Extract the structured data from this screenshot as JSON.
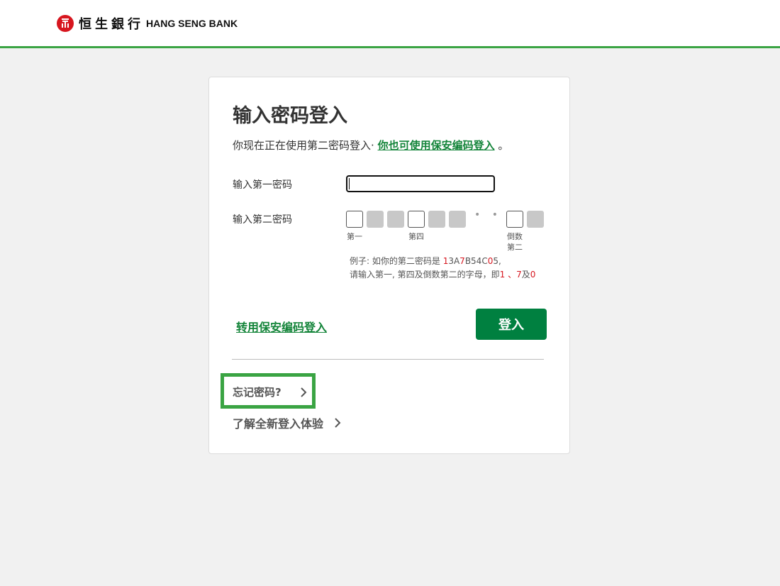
{
  "header": {
    "brand_cn": "恒生銀行",
    "brand_en": "HANG SENG BANK",
    "accent_color": "#3aa443",
    "logo_color": "#d7161f"
  },
  "login": {
    "title": "输入密码登入",
    "desc_prefix": "你现在正在使用第二密码登入·",
    "desc_link": "你也可使用保安编码登入",
    "desc_suffix": "。",
    "first_password_label": "输入第一密码",
    "first_password_value": "",
    "second_password_label": "输入第二密码",
    "box_labels": {
      "first": "第一",
      "fourth": "第四",
      "second_last_line1": "倒数",
      "second_last_line2": "第二"
    },
    "dots": "• • •",
    "example": {
      "line1_prefix": "例子: 如你的第二密码是 ",
      "code_part1": "1",
      "code_part2": "3A",
      "code_part3": "7",
      "code_part4": "B54C",
      "code_part5": "0",
      "code_part6": "5,",
      "line2_prefix": "请输入第一, 第四及倒数第二的字母，即",
      "answer1": "1",
      "sep1": " 、",
      "answer2": "7",
      "sep2": "及",
      "answer3": "0"
    },
    "switch_link": "转用保安编码登入",
    "login_button": "登入",
    "forgot_password": "忘记密码?",
    "learn_more": "了解全新登入体验"
  }
}
